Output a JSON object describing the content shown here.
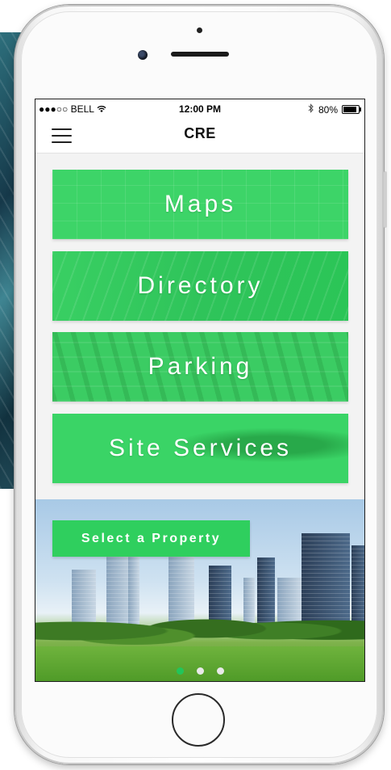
{
  "status_bar": {
    "carrier": "●●●○○ BELL",
    "time": "12:00 PM",
    "battery": "80%",
    "battery_level": 0.8
  },
  "nav": {
    "title": "CRE",
    "menu_icon": "hamburger-menu-icon"
  },
  "tiles": [
    {
      "label": "Maps"
    },
    {
      "label": "Directory"
    },
    {
      "label": "Parking"
    },
    {
      "label": "Site Services"
    }
  ],
  "banner": {
    "button_label": "Select a Property",
    "pages": 3,
    "active_page": 1
  },
  "colors": {
    "accent": "#2fcf5e",
    "active_dot": "#22c55a"
  }
}
